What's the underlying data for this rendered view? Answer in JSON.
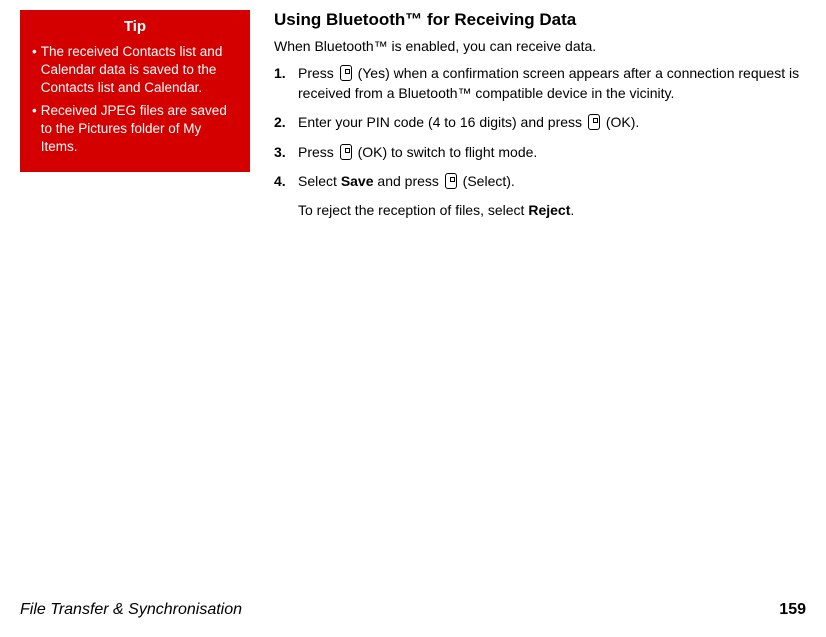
{
  "sidebar": {
    "tip_label": "Tip",
    "tips": [
      "The received Contacts list and Calendar data is saved to the Contacts list and Calendar.",
      "Received JPEG files are saved to the Pictures folder of My Items."
    ]
  },
  "main": {
    "heading": "Using Bluetooth™ for Receiving Data",
    "intro": "When Bluetooth™ is enabled, you can receive data.",
    "steps": [
      {
        "num": "1.",
        "pre": "Press ",
        "post": " (Yes) when a confirmation screen appears after a connection request is received from a Bluetooth™ compatible device in the vicinity."
      },
      {
        "num": "2.",
        "pre": "Enter your PIN code (4 to 16 digits) and press ",
        "post": " (OK)."
      },
      {
        "num": "3.",
        "pre": "Press ",
        "post": " (OK) to switch to flight mode."
      },
      {
        "num": "4.",
        "pre": "Select ",
        "bold1": "Save",
        "mid": " and press ",
        "post": " (Select).",
        "note_pre": "To reject the reception of files, select ",
        "note_bold": "Reject",
        "note_post": "."
      }
    ]
  },
  "footer": {
    "section": "File Transfer & Synchronisation",
    "page": "159"
  }
}
